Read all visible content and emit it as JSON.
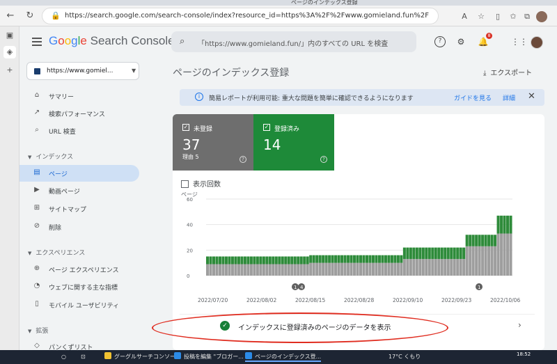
{
  "browser": {
    "tab_title": "ページのインデックス登録",
    "url": "https://search.google.com/search-console/index?resource_id=https%3A%2F%2Fwww.gomieland.fun%2F"
  },
  "header": {
    "brand_google": [
      "G",
      "o",
      "o",
      "g",
      "l",
      "e"
    ],
    "brand_product": "Search Console",
    "search_placeholder": "「https://www.gomieland.fun/」内のすべての URL を検査",
    "notification_count": "8"
  },
  "sidebar": {
    "property": "https://www.gomiel...",
    "top_items": [
      {
        "label": "サマリー",
        "icon": "home-icon"
      },
      {
        "label": "検索パフォーマンス",
        "icon": "trending-icon"
      },
      {
        "label": "URL 検査",
        "icon": "search-icon"
      }
    ],
    "sections": [
      {
        "title": "インデックス",
        "items": [
          {
            "label": "ページ",
            "icon": "pages-icon",
            "active": true
          },
          {
            "label": "動画ページ",
            "icon": "video-icon"
          },
          {
            "label": "サイトマップ",
            "icon": "sitemap-icon"
          },
          {
            "label": "削除",
            "icon": "eye-off-icon"
          }
        ]
      },
      {
        "title": "エクスペリエンス",
        "items": [
          {
            "label": "ページ エクスペリエンス",
            "icon": "plus-circle-icon"
          },
          {
            "label": "ウェブに関する主な指標",
            "icon": "speed-icon"
          },
          {
            "label": "モバイル ユーザビリティ",
            "icon": "phone-icon"
          }
        ]
      },
      {
        "title": "拡張",
        "items": [
          {
            "label": "パンくずリスト",
            "icon": "layers-icon"
          }
        ]
      }
    ]
  },
  "main": {
    "title": "ページのインデックス登録",
    "export": "エクスポート",
    "banner": {
      "text": "簡易レポートが利用可能: 重大な問題を簡単に確認できるようになります",
      "link1": "ガイドを見る",
      "link2": "詳細"
    },
    "not_indexed": {
      "label": "未登録",
      "value": "37",
      "sub": "理由 5"
    },
    "indexed": {
      "label": "登録済み",
      "value": "14"
    },
    "impressions_label": "表示回数",
    "action_text": "インデックスに登録済みのページのデータを表示"
  },
  "chart_data": {
    "type": "bar",
    "ylabel": "ページ",
    "ylim": [
      0,
      60
    ],
    "yticks": [
      0,
      20,
      40,
      60
    ],
    "xtick_labels": [
      "2022/07/20",
      "2022/08/02",
      "2022/08/15",
      "2022/08/28",
      "2022/09/10",
      "2022/09/23",
      "2022/10/06"
    ],
    "stacked": true,
    "series": [
      {
        "name": "未登録",
        "color": "#9e9e9e",
        "values": [
          9,
          9,
          9,
          9,
          9,
          9,
          9,
          9,
          9,
          9,
          9,
          9,
          9,
          9,
          9,
          9,
          9,
          9,
          9,
          9,
          9,
          9,
          9,
          9,
          9,
          9,
          9,
          9,
          9,
          9,
          9,
          9,
          9,
          10,
          10,
          10,
          10,
          10,
          10,
          10,
          10,
          10,
          10,
          10,
          10,
          10,
          10,
          10,
          10,
          10,
          10,
          10,
          10,
          10,
          10,
          10,
          10,
          10,
          10,
          10,
          10,
          10,
          10,
          13,
          13,
          13,
          13,
          13,
          13,
          13,
          13,
          13,
          13,
          13,
          13,
          13,
          13,
          13,
          13,
          13,
          13,
          13,
          13,
          23,
          23,
          23,
          23,
          23,
          23,
          23,
          23,
          23,
          23,
          33,
          33,
          33,
          33,
          33
        ]
      },
      {
        "name": "登録済み",
        "color": "#2e8b3a",
        "values": [
          6,
          6,
          6,
          6,
          6,
          6,
          6,
          6,
          6,
          6,
          6,
          6,
          6,
          6,
          6,
          6,
          6,
          6,
          6,
          6,
          6,
          6,
          6,
          6,
          6,
          6,
          6,
          6,
          6,
          6,
          6,
          6,
          6,
          6,
          6,
          6,
          6,
          6,
          6,
          6,
          6,
          6,
          6,
          6,
          6,
          6,
          6,
          6,
          6,
          6,
          6,
          6,
          6,
          6,
          6,
          6,
          6,
          6,
          6,
          6,
          6,
          6,
          6,
          9,
          9,
          9,
          9,
          9,
          9,
          9,
          9,
          9,
          9,
          9,
          9,
          9,
          9,
          9,
          9,
          9,
          9,
          9,
          9,
          9,
          9,
          9,
          9,
          9,
          9,
          9,
          9,
          9,
          9,
          14,
          14,
          14,
          14,
          14
        ]
      }
    ],
    "annotations": [
      {
        "label": "1",
        "x": "2022/08/15"
      },
      {
        "label": "4",
        "x": "2022/08/15"
      },
      {
        "label": "1",
        "x": "2022/10/06"
      }
    ]
  },
  "taskbar": {
    "items": [
      "グーグルサーチコンソール",
      "投稿を編集 \"ブロガー...",
      "ページのインデックス登..."
    ],
    "weather": "17°C くもり",
    "time": "18:52"
  }
}
